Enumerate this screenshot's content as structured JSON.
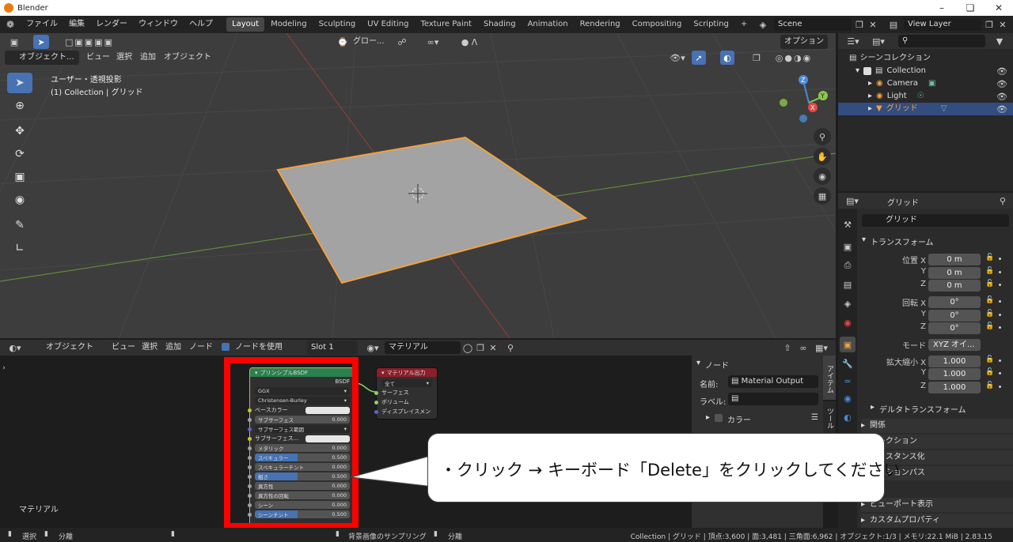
{
  "window": {
    "title": "Blender"
  },
  "menu": {
    "items": [
      "ファイル",
      "編集",
      "レンダー",
      "ウィンドウ",
      "ヘルプ"
    ]
  },
  "workspaces": [
    "Layout",
    "Modeling",
    "Sculpting",
    "UV Editing",
    "Texture Paint",
    "Shading",
    "Animation",
    "Rendering",
    "Compositing",
    "Scripting"
  ],
  "scene": {
    "name": "Scene",
    "view_layer": "View Layer"
  },
  "viewport": {
    "mode": "オブジェクト...",
    "menus": [
      "ビュー",
      "選択",
      "追加",
      "オブジェクト"
    ],
    "transform": "グロー...",
    "options": "オプション",
    "view_name": "ユーザー・透視投影",
    "collection": "(1) Collection | グリッド"
  },
  "outliner": {
    "root": "シーンコレクション",
    "items": [
      {
        "name": "Collection"
      },
      {
        "name": "Camera"
      },
      {
        "name": "Light"
      },
      {
        "name": "グリッド"
      }
    ]
  },
  "properties": {
    "object_name": "グリッド",
    "mesh_name": "グリッド",
    "section_transform": "トランスフォーム",
    "location": {
      "label": "位置 X",
      "values": [
        "0 m",
        "0 m",
        "0 m"
      ]
    },
    "rotation": {
      "label": "回転 X",
      "values": [
        "0°",
        "0°",
        "0°"
      ]
    },
    "mode": {
      "label": "モード",
      "value": "XYZ オイ..."
    },
    "scale": {
      "label": "拡大縮小 X",
      "values": [
        "1.000",
        "1.000",
        "1.000"
      ]
    },
    "axes": [
      "Y",
      "Z"
    ],
    "delta": "デルタトランスフォーム",
    "sections": [
      "関係",
      "コレクション",
      "インスタンス化",
      "モーションパス",
      "ビューポート表示",
      "カスタムプロパティ"
    ]
  },
  "node_editor": {
    "mode": "オブジェクト",
    "menus": [
      "ビュー",
      "選択",
      "追加",
      "ノード"
    ],
    "use_nodes": "ノードを使用",
    "slot": "Slot 1",
    "material": "マテリアル",
    "bottom_label": "マテリアル"
  },
  "bsdf": {
    "title": "プリンシプルBSDF",
    "out": "BSDF",
    "dist": "GGX",
    "sss": "Christensen-Burley",
    "rows": [
      {
        "label": "ベースカラー",
        "value": ""
      },
      {
        "label": "サブサーフェス",
        "value": "0.000"
      },
      {
        "label": "サブサーフェス範囲",
        "value": ""
      },
      {
        "label": "サブサーフェス...",
        "value": ""
      },
      {
        "label": "メタリック",
        "value": "0.000"
      },
      {
        "label": "スペキュラー",
        "value": "0.500"
      },
      {
        "label": "スペキュラーチント",
        "value": "0.000"
      },
      {
        "label": "粗さ",
        "value": "0.500"
      },
      {
        "label": "異方性",
        "value": "0.000"
      },
      {
        "label": "異方性の回転",
        "value": "0.000"
      },
      {
        "label": "シーン",
        "value": "0.000"
      },
      {
        "label": "シーンチント",
        "value": "0.500"
      }
    ]
  },
  "output_node": {
    "title": "マテリアル出力",
    "target": "全て",
    "inputs": [
      "サーフェス",
      "ボリューム",
      "ディスプレイスメン"
    ]
  },
  "sidebar_panel": {
    "section": "ノード",
    "name_label": "名前:",
    "name_value": "Material Output",
    "label_label": "ラベル:",
    "color": "カラー",
    "tabs": [
      "アイテム",
      "ツール"
    ]
  },
  "callout": {
    "text": "・クリック → キーボード「Delete」をクリックしてください"
  },
  "status": {
    "left": [
      "選択",
      "分離"
    ],
    "middle": "背景画像のサンプリング",
    "middle2": "分離",
    "right": "Collection | グリッド | 頂点:3,600 | 面:3,481 | 三角面:6,962 | オブジェクト:1/3 | メモリ:22.1 MiB | 2.83.15"
  },
  "colors": {
    "accent": "#4772b3",
    "highlight": "#ff0000",
    "selected_edge": "#f2a13e",
    "bsdf_header": "#29814f",
    "output_header": "#8b1f2b"
  }
}
